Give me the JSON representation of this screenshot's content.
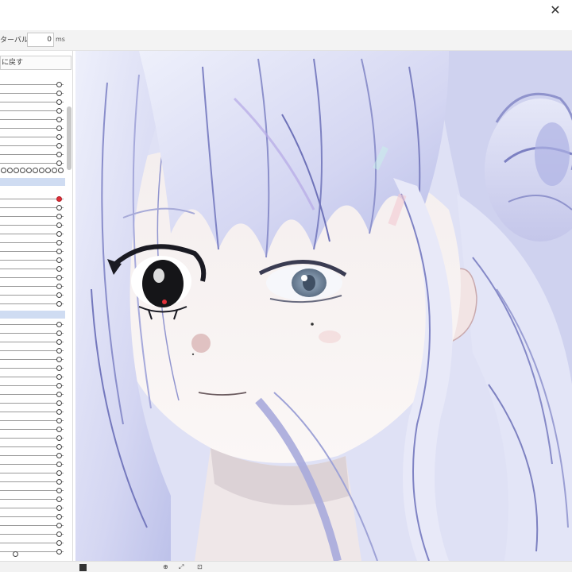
{
  "window": {
    "close_glyph": "✕"
  },
  "toolbar": {
    "interval_label": "ターバル :",
    "interval_value": "0",
    "interval_unit": "ms"
  },
  "panel": {
    "reset_label": "に戻す",
    "accent_color": "#cfdcf2",
    "knob_active_color": "#e0303a"
  },
  "canvas": {
    "content": "anime-girl-illustration",
    "background_color": "#3a3a3e"
  },
  "statusbar": {
    "zoom_in_icon": "zoom-icon",
    "fit_icon": "fullscreen-icon"
  }
}
